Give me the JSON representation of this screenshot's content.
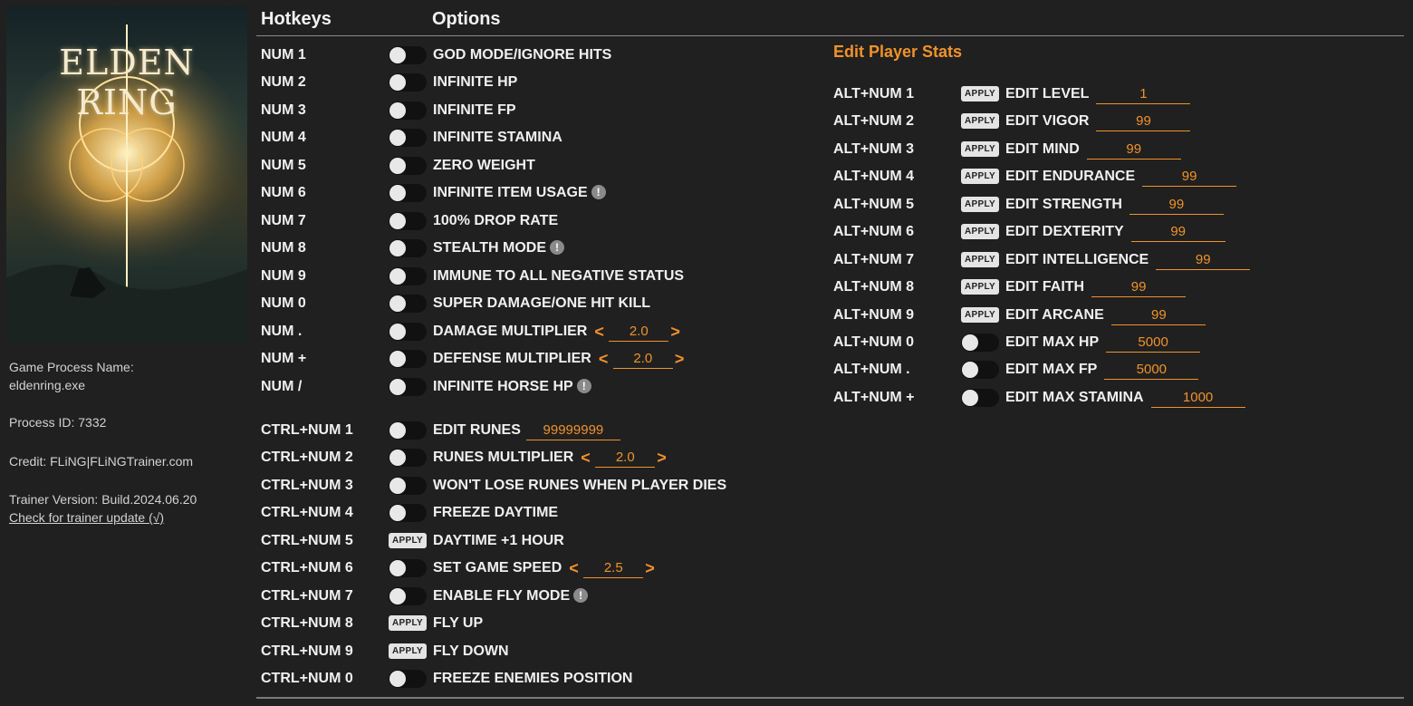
{
  "sidebar": {
    "cover_title": "ELDEN RING",
    "process_name_label": "Game Process Name:",
    "process_name": "eldenring.exe",
    "process_id": "Process ID: 7332",
    "credit": "Credit: FLiNG|FLiNGTrainer.com",
    "version": "Trainer Version: Build.2024.06.20",
    "update_link": "Check for trainer update (√)"
  },
  "header": {
    "hotkeys": "Hotkeys",
    "options": "Options"
  },
  "section": {
    "player_stats_title": "Edit Player Stats"
  },
  "apply_label": "APPLY",
  "arrows": {
    "left": "<",
    "right": ">"
  },
  "warn_glyph": "!",
  "options": [
    {
      "hotkey": "NUM 1",
      "control": "toggle",
      "label": "GOD MODE/IGNORE HITS"
    },
    {
      "hotkey": "NUM 2",
      "control": "toggle",
      "label": "INFINITE HP"
    },
    {
      "hotkey": "NUM 3",
      "control": "toggle",
      "label": "INFINITE FP"
    },
    {
      "hotkey": "NUM 4",
      "control": "toggle",
      "label": "INFINITE STAMINA"
    },
    {
      "hotkey": "NUM 5",
      "control": "toggle",
      "label": "ZERO WEIGHT"
    },
    {
      "hotkey": "NUM 6",
      "control": "toggle",
      "label": "INFINITE ITEM USAGE",
      "warn": true
    },
    {
      "hotkey": "NUM 7",
      "control": "toggle",
      "label": "100% DROP RATE"
    },
    {
      "hotkey": "NUM 8",
      "control": "toggle",
      "label": "STEALTH MODE",
      "warn": true
    },
    {
      "hotkey": "NUM 9",
      "control": "toggle",
      "label": "IMMUNE TO ALL NEGATIVE STATUS"
    },
    {
      "hotkey": "NUM 0",
      "control": "toggle",
      "label": "SUPER DAMAGE/ONE HIT KILL"
    },
    {
      "hotkey": "NUM .",
      "control": "toggle",
      "label": "DAMAGE MULTIPLIER",
      "stepper": "2.0"
    },
    {
      "hotkey": "NUM +",
      "control": "toggle",
      "label": "DEFENSE MULTIPLIER",
      "stepper": "2.0"
    },
    {
      "hotkey": "NUM /",
      "control": "toggle",
      "label": "INFINITE HORSE HP",
      "warn": true
    },
    {
      "hotkey": "CTRL+NUM 1",
      "control": "toggle",
      "label": "EDIT RUNES",
      "input": "99999999"
    },
    {
      "hotkey": "CTRL+NUM 2",
      "control": "toggle",
      "label": "RUNES MULTIPLIER",
      "stepper": "2.0"
    },
    {
      "hotkey": "CTRL+NUM 3",
      "control": "toggle",
      "label": "WON'T LOSE RUNES WHEN PLAYER DIES"
    },
    {
      "hotkey": "CTRL+NUM 4",
      "control": "toggle",
      "label": "FREEZE DAYTIME"
    },
    {
      "hotkey": "CTRL+NUM 5",
      "control": "apply",
      "label": "DAYTIME +1 HOUR"
    },
    {
      "hotkey": "CTRL+NUM 6",
      "control": "toggle",
      "label": "SET GAME SPEED",
      "stepper": "2.5"
    },
    {
      "hotkey": "CTRL+NUM 7",
      "control": "toggle",
      "label": "ENABLE FLY MODE",
      "warn": true
    },
    {
      "hotkey": "CTRL+NUM 8",
      "control": "apply",
      "label": "FLY UP"
    },
    {
      "hotkey": "CTRL+NUM 9",
      "control": "apply",
      "label": "FLY DOWN"
    },
    {
      "hotkey": "CTRL+NUM 0",
      "control": "toggle",
      "label": "FREEZE ENEMIES POSITION"
    }
  ],
  "stats": [
    {
      "hotkey": "ALT+NUM 1",
      "control": "apply",
      "label": "EDIT LEVEL",
      "value": "1"
    },
    {
      "hotkey": "ALT+NUM 2",
      "control": "apply",
      "label": "EDIT VIGOR",
      "value": "99"
    },
    {
      "hotkey": "ALT+NUM 3",
      "control": "apply",
      "label": "EDIT MIND",
      "value": "99"
    },
    {
      "hotkey": "ALT+NUM 4",
      "control": "apply",
      "label": "EDIT ENDURANCE",
      "value": "99"
    },
    {
      "hotkey": "ALT+NUM 5",
      "control": "apply",
      "label": "EDIT STRENGTH",
      "value": "99"
    },
    {
      "hotkey": "ALT+NUM 6",
      "control": "apply",
      "label": "EDIT DEXTERITY",
      "value": "99"
    },
    {
      "hotkey": "ALT+NUM 7",
      "control": "apply",
      "label": "EDIT INTELLIGENCE",
      "value": "99"
    },
    {
      "hotkey": "ALT+NUM 8",
      "control": "apply",
      "label": "EDIT FAITH",
      "value": "99"
    },
    {
      "hotkey": "ALT+NUM 9",
      "control": "apply",
      "label": "EDIT ARCANE",
      "value": "99"
    },
    {
      "hotkey": "ALT+NUM 0",
      "control": "toggle",
      "label": "EDIT MAX HP",
      "value": "5000"
    },
    {
      "hotkey": "ALT+NUM .",
      "control": "toggle",
      "label": "EDIT MAX FP",
      "value": "5000"
    },
    {
      "hotkey": "ALT+NUM +",
      "control": "toggle",
      "label": "EDIT MAX STAMINA",
      "value": "1000"
    }
  ]
}
